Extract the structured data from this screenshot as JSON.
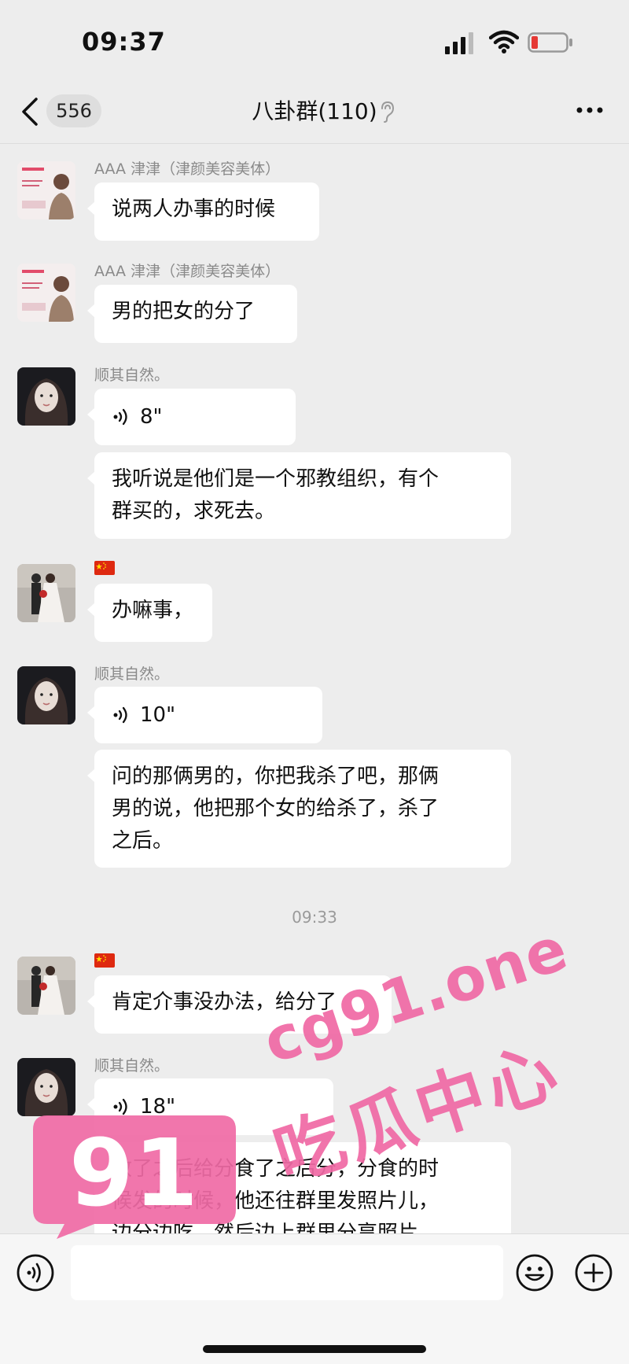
{
  "status_bar": {
    "time": "09:37"
  },
  "nav": {
    "unread_count": "556",
    "title": "八卦群(110)"
  },
  "messages": [
    {
      "sender": "AAA 津津（津颜美容美体）",
      "text": "说两人办事的时候"
    },
    {
      "sender": "AAA 津津（津颜美容美体）",
      "text": "男的把女的分了"
    },
    {
      "sender": "顺其自然。",
      "voice_duration": "8\"",
      "text_line1": "我听说是他们是一个邪教组织，有个",
      "text_line2": "群买的，求死去。"
    },
    {
      "sender_flag": "china-flag-icon",
      "text": "办嘛事，"
    },
    {
      "sender": "顺其自然。",
      "voice_duration": "10\"",
      "text_line1": "问的那俩男的，你把我杀了吧，那俩",
      "text_line2": "男的说，他把那个女的给杀了，杀了",
      "text_line3": "之后。"
    },
    {
      "sender_flag": "china-flag-icon",
      "text": "肯定介事没办法，给分了"
    },
    {
      "sender": "顺其自然。",
      "voice_duration": "18\"",
      "text_line1": "散了之后给分食了之后分，分食的时",
      "text_line2": "候发的时候，他还往群里发照片儿，",
      "text_line3": "边分边吃，然后边上群里分享照片"
    }
  ],
  "time_divider": "09:33",
  "watermark": {
    "logo_text": "91",
    "url": "cg91.one",
    "slogan": "吃瓜中心"
  },
  "colors": {
    "background": "#ededed",
    "bubble": "#ffffff",
    "watermark": "#f06aa5",
    "battery_low": "#e53935"
  }
}
